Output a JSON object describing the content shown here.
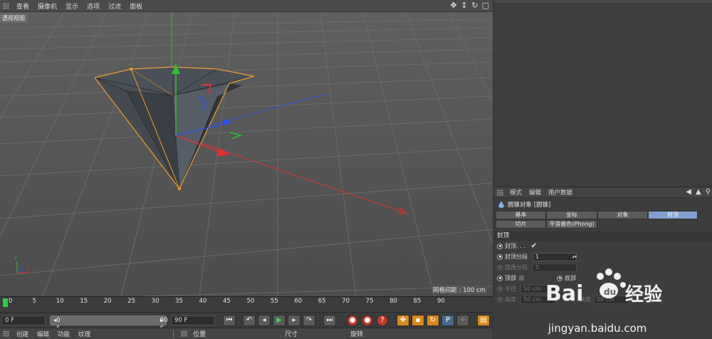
{
  "viewport": {
    "menu": [
      "查看",
      "摄像机",
      "显示",
      "选项",
      "过滤",
      "面板"
    ],
    "label": "透视视图",
    "grid_distance": "网格间距 : 100 cm",
    "tool_icons": [
      "move-icon",
      "zoom-icon",
      "rotate-icon",
      "maximize-icon"
    ]
  },
  "timeline": {
    "ticks": [
      "0",
      "5",
      "10",
      "15",
      "20",
      "25",
      "30",
      "35",
      "40",
      "45",
      "50",
      "55",
      "60",
      "65",
      "70",
      "75",
      "80",
      "85",
      "90"
    ],
    "current_frame_right": "0 F"
  },
  "transport": {
    "start_frame": "0 F",
    "range_start": "0 F",
    "range_end": "90 F",
    "end_frame": "90 F"
  },
  "bottom_menu": {
    "items": [
      "创建",
      "编辑",
      "功能",
      "纹理"
    ],
    "coord_headers": [
      "位置",
      "尺寸",
      "旋转"
    ]
  },
  "attributes": {
    "menu": [
      "模式",
      "编辑",
      "用户数据"
    ],
    "object_title": "圆锥对象 [圆锥]",
    "tabs_row1": [
      "基本",
      "坐标",
      "对象",
      "封顶"
    ],
    "tabs_row2": [
      "切片",
      "平滑着色(Phong)"
    ],
    "active_tab": "封顶",
    "section": "封顶",
    "props": {
      "cap_label": "封顶",
      "cap_dots": " . . .",
      "cap_check": "✔",
      "cap_segments_label": "封顶分段",
      "cap_segments_value": "1",
      "fillet_segments_label": "圆角分段",
      "fillet_segments_value": "5",
      "top_label": "顶部",
      "bottom_label": "底部",
      "radius_label": "半径",
      "radius_value": "50 cm",
      "height_label": "高度",
      "height_value": "50 cm",
      "height2_label": "高度",
      "height2_value": "50 cm"
    }
  },
  "watermark": {
    "brand": "Bai",
    "brand_cn": "经验",
    "url": "jingyan.baidu.com"
  },
  "colors": {
    "x_axis": "#e03030",
    "y_axis": "#30c030",
    "z_axis": "#3050e0",
    "selection": "#f0a030",
    "active_tab": "#7f9fd0"
  }
}
